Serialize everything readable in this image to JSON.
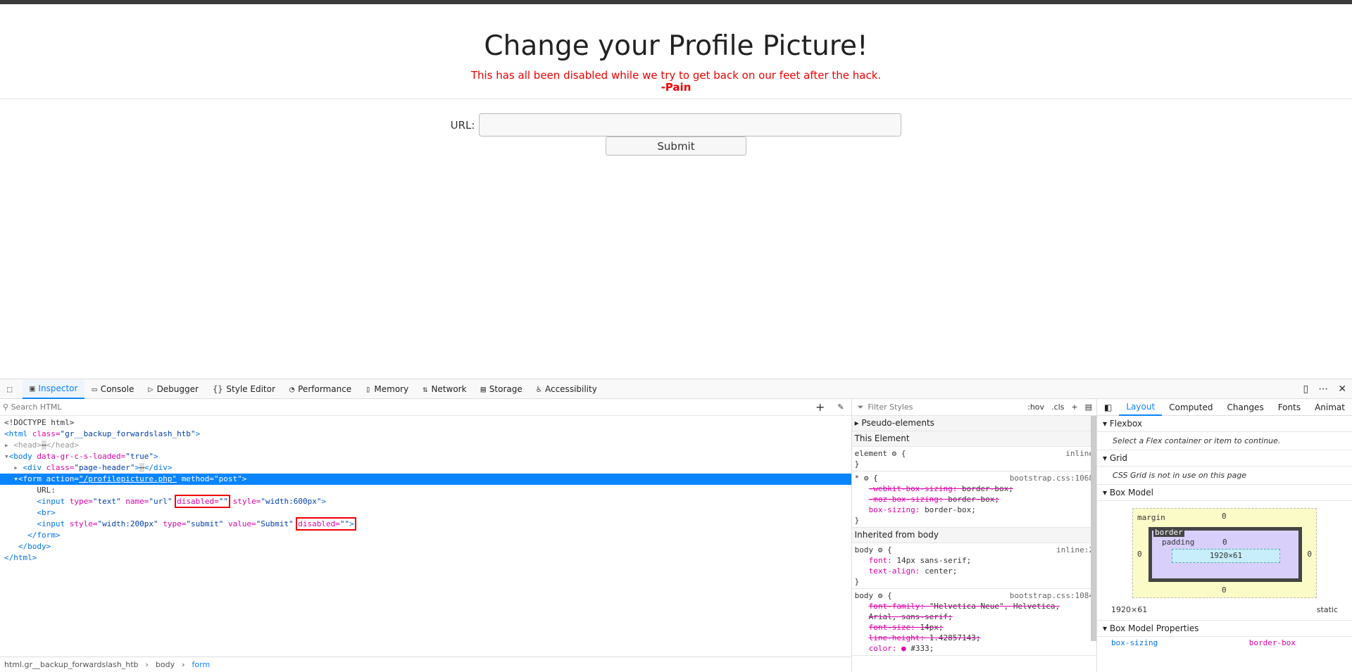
{
  "page": {
    "title": "Change your Profile Picture!",
    "warning": "This has all been disabled while we try to get back on our feet after the hack.",
    "signature": "-Pain",
    "url_label": "URL:",
    "submit_label": "Submit"
  },
  "devtools": {
    "tabs": [
      {
        "label": "Inspector",
        "icon": "inspector-icon"
      },
      {
        "label": "Console",
        "icon": "console-icon"
      },
      {
        "label": "Debugger",
        "icon": "debugger-icon"
      },
      {
        "label": "Style Editor",
        "icon": "style-editor-icon"
      },
      {
        "label": "Performance",
        "icon": "performance-icon"
      },
      {
        "label": "Memory",
        "icon": "memory-icon"
      },
      {
        "label": "Network",
        "icon": "network-icon"
      },
      {
        "label": "Storage",
        "icon": "storage-icon"
      },
      {
        "label": "Accessibility",
        "icon": "accessibility-icon"
      }
    ],
    "search_placeholder": "Search HTML",
    "html_lines": {
      "l1": "<!DOCTYPE html>",
      "l2_tag": "<html",
      "l2_attr": "class=",
      "l2_val": "\"gr__backup_forwardslash_htb\"",
      "l3": "<head>",
      "l3_end": "</head>",
      "l4_tag": "<body",
      "l4_attr": "data-gr-c-s-loaded=",
      "l4_val": "\"true\"",
      "l5_tag": "<div",
      "l5_attr": "class=",
      "l5_val": "\"page-header\"",
      "l5_end": "</div>",
      "l6_tag": "<form",
      "l6_attr1": "action=",
      "l6_val1": "\"/profilepicture.php\"",
      "l6_attr2": "method=",
      "l6_val2": "\"post\"",
      "l7": "URL:",
      "l8_tag": "<input",
      "l8_a1": "type=",
      "l8_v1": "\"text\"",
      "l8_a2": "name=",
      "l8_v2": "\"url\"",
      "l8_a3": "disabled=",
      "l8_v3": "\"\"",
      "l8_a4": "style=",
      "l8_v4": "\"width:600px\"",
      "l9": "<br>",
      "l10_tag": "<input",
      "l10_a1": "style=",
      "l10_v1": "\"width:200px\"",
      "l10_a2": "type=",
      "l10_v2": "\"submit\"",
      "l10_a3": "value=",
      "l10_v3": "\"Submit\"",
      "l10_a4": "disabled=",
      "l10_v4": "\"\"",
      "l11": "</form>",
      "l12": "</body>",
      "l13": "</html>"
    },
    "breadcrumbs": [
      "html.gr__backup_forwardslash_htb",
      "body",
      "form"
    ],
    "filter_placeholder": "Filter Styles",
    "hov": ":hov",
    "cls": ".cls",
    "rules": {
      "pseudo": "Pseudo-elements",
      "this_element": "This Element",
      "r1_sel": "element",
      "r1_src": "inline",
      "r2_sel": "*",
      "r2_src": "bootstrap.css:1068",
      "r2_p1": "-webkit-box-sizing:",
      "r2_p1v": "border-box;",
      "r2_p2": "-moz-box-sizing:",
      "r2_p2v": "border-box;",
      "r2_p3": "box-sizing:",
      "r2_p3v": "border-box;",
      "inherited": "Inherited from body",
      "r3_sel": "body",
      "r3_src": "inline:2",
      "r3_p1": "font:",
      "r3_p1v": "14px sans-serif;",
      "r3_p2": "text-align:",
      "r3_p2v": "center;",
      "r4_sel": "body",
      "r4_src": "bootstrap.css:1084",
      "r4_p1": "font-family:",
      "r4_p1v": "\"Helvetica Neue\", Helvetica,",
      "r4_p1v2": "Arial, sans-serif;",
      "r4_p2": "font-size:",
      "r4_p2v": "14px;",
      "r4_p3": "line-height:",
      "r4_p3v": "1.42857143;",
      "r4_p4": "color:",
      "r4_p4v": "#333;"
    },
    "layout": {
      "tabs": [
        "Layout",
        "Computed",
        "Changes",
        "Fonts",
        "Animat"
      ],
      "flexbox": "Flexbox",
      "flex_note": "Select a Flex container or item to continue.",
      "grid": "Grid",
      "grid_note": "CSS Grid is not in use on this page",
      "box_model": "Box Model",
      "margin": "margin",
      "border": "border",
      "padding": "padding",
      "content": "1920×61",
      "zero": "0",
      "dims": "1920×61",
      "position": "static",
      "props": "Box Model Properties",
      "prop1": "box-sizing",
      "prop1v": "border-box"
    }
  }
}
